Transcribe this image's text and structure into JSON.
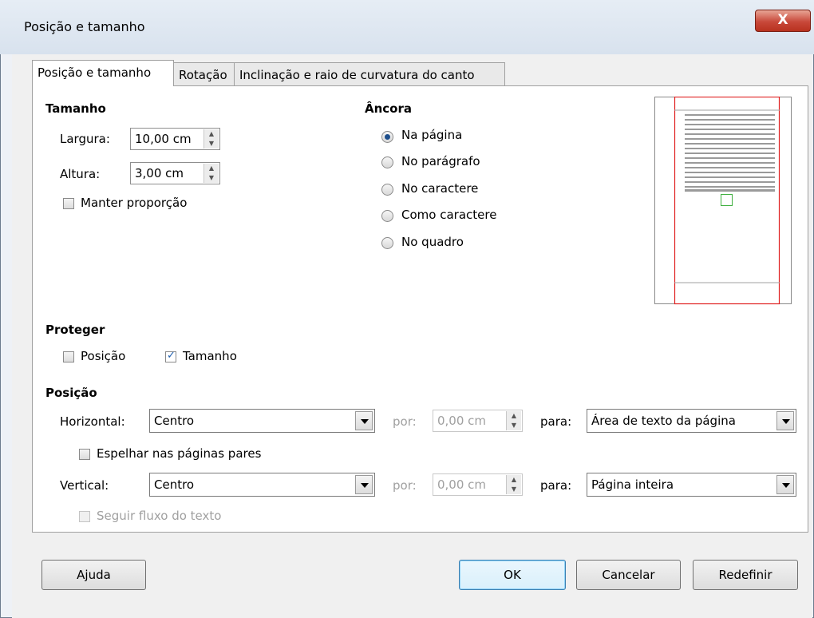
{
  "window": {
    "title": "Posição e tamanho",
    "close_label": "X"
  },
  "tabs": [
    {
      "label": "Posição e tamanho",
      "active": true
    },
    {
      "label": "Rotação",
      "active": false
    },
    {
      "label": "Inclinação e raio de curvatura do canto",
      "active": false
    }
  ],
  "size": {
    "heading": "Tamanho",
    "width_label": "Largura:",
    "width_value": "10,00 cm",
    "height_label": "Altura:",
    "height_value": "3,00 cm",
    "keep_ratio_label": "Manter proporção",
    "keep_ratio_checked": false
  },
  "anchor": {
    "heading": "Âncora",
    "options": [
      {
        "label": "Na página",
        "selected": true
      },
      {
        "label": "No parágrafo",
        "selected": false
      },
      {
        "label": "No caractere",
        "selected": false
      },
      {
        "label": "Como caractere",
        "selected": false
      },
      {
        "label": "No quadro",
        "selected": false
      }
    ]
  },
  "protect": {
    "heading": "Proteger",
    "position_label": "Posição",
    "position_checked": false,
    "size_label": "Tamanho",
    "size_checked": true
  },
  "position": {
    "heading": "Posição",
    "horizontal_label": "Horizontal:",
    "horizontal_value": "Centro",
    "by_label": "por:",
    "horizontal_by_value": "0,00 cm",
    "to_label": "para:",
    "horizontal_to_value": "Área de texto da página",
    "mirror_label": "Espelhar nas páginas pares",
    "mirror_checked": false,
    "vertical_label": "Vertical:",
    "vertical_value": "Centro",
    "vertical_by_value": "0,00 cm",
    "vertical_to_value": "Página inteira",
    "follow_label": "Seguir fluxo do texto",
    "follow_checked": false
  },
  "buttons": {
    "help": "Ajuda",
    "ok": "OK",
    "cancel": "Cancelar",
    "reset": "Redefinir"
  },
  "colors": {
    "preview_page_border": "#e02020",
    "preview_object": "#40b040",
    "title_bar": "#dbe4ef"
  }
}
